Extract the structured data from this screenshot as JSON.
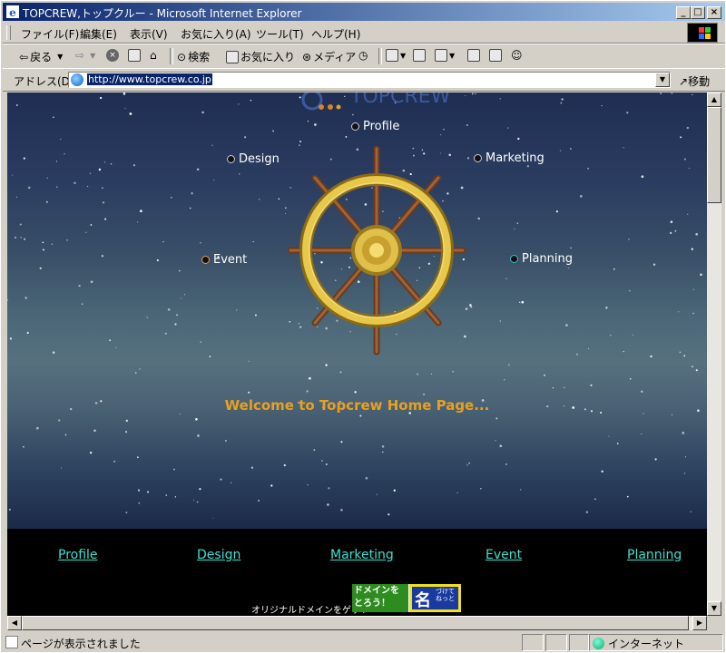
{
  "window": {
    "title": "TOPCREW,トップクルー - Microsoft Internet Explorer",
    "minimize": "_",
    "maximize": "□",
    "close": "×"
  },
  "menu": {
    "items": [
      "ファイル(F)",
      "編集(E)",
      "表示(V)",
      "お気に入り(A)",
      "ツール(T)",
      "ヘルプ(H)"
    ]
  },
  "toolbar": {
    "back": "戻る",
    "search": "検索",
    "favorites": "お気に入り",
    "media": "メディア"
  },
  "address": {
    "label": "アドレス(D)",
    "url": "http://www.topcrew.co.jp",
    "go": "移動"
  },
  "page": {
    "logo_text": "TOPCREW",
    "wheel_nav": {
      "profile": "Profile",
      "design": "Design",
      "marketing": "Marketing",
      "event": "Event",
      "planning": "Planning"
    },
    "welcome": "Welcome to Topcrew Home Page...",
    "bottom_links": [
      "Profile",
      "Design",
      "Marketing",
      "Event",
      "Planning"
    ],
    "domain_text": "オリジナルドメインをゲット",
    "domain_banner": {
      "left_text": "ドメインをとろう！",
      "kanji": "名",
      "small_text": "づけてねっと"
    }
  },
  "status": {
    "text": "ページが表示されました",
    "zone": "インターネット"
  },
  "colors": {
    "welcome": "#e8a020",
    "link": "#40e0d0",
    "titlebar": "#0a246a"
  }
}
